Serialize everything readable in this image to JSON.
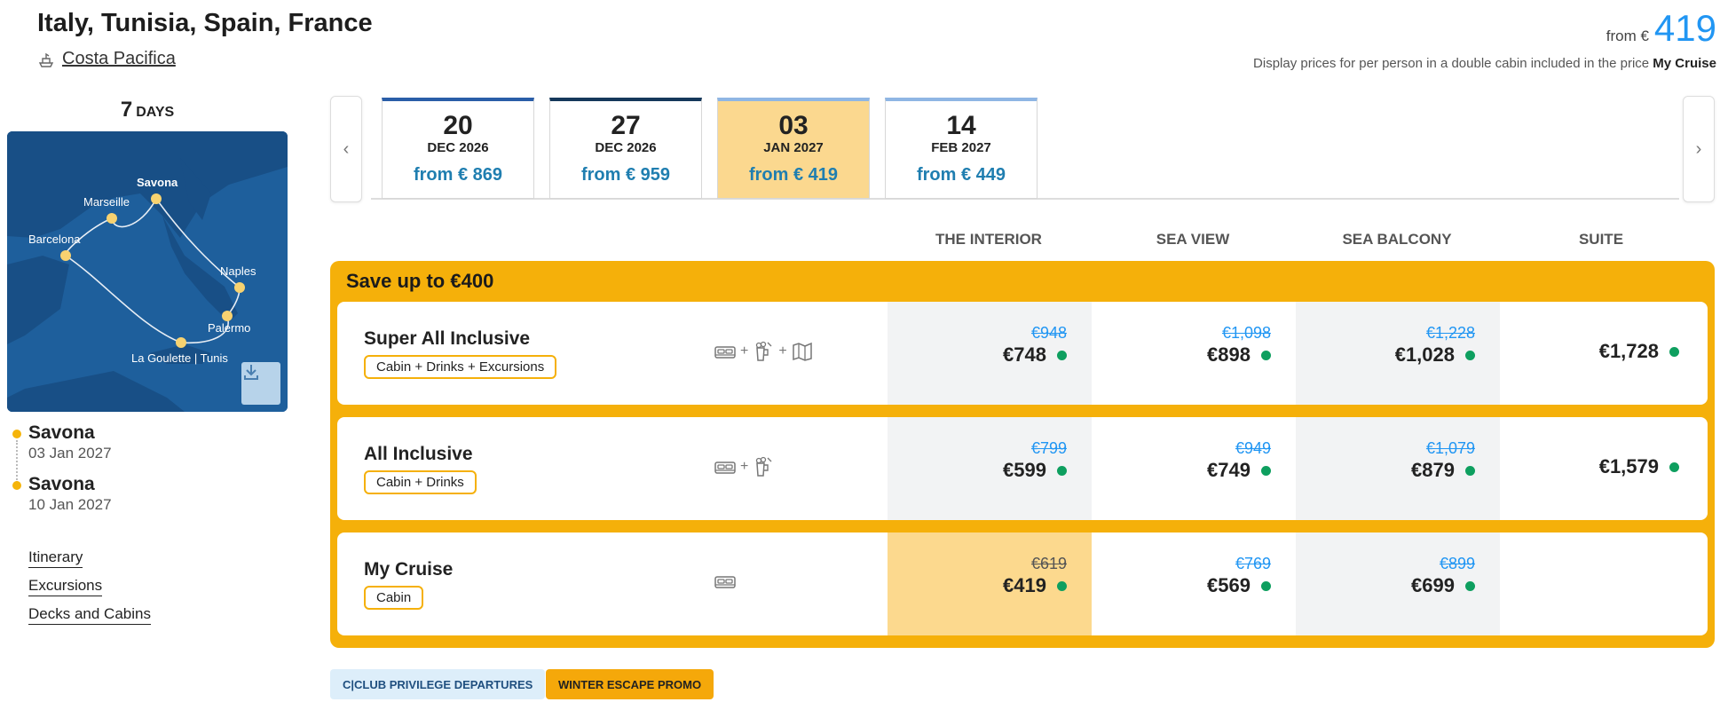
{
  "header": {
    "title": "Italy, Tunisia, Spain, France",
    "ship": "Costa Pacifica",
    "from_label": "from €",
    "from_price": "419",
    "note_prefix": "Display prices for per person in a double cabin included in the price",
    "note_bold": "My Cruise"
  },
  "duration": {
    "number": "7",
    "unit": "DAYS"
  },
  "map": {
    "labels": [
      "Savona",
      "Marseille",
      "Barcelona",
      "Naples",
      "Palermo",
      "La Goulette | Tunis"
    ],
    "download_icon": "download-icon"
  },
  "ports": [
    {
      "name": "Savona",
      "date": "03 Jan 2027"
    },
    {
      "name": "Savona",
      "date": "10 Jan 2027"
    }
  ],
  "links": [
    "Itinerary",
    "Excursions",
    "Decks and Cabins"
  ],
  "date_tabs": [
    {
      "day": "20",
      "month": "DEC 2026",
      "price": "from € 869",
      "accent": "#2a5ea8"
    },
    {
      "day": "27",
      "month": "DEC 2026",
      "price": "from € 959",
      "accent": "#15385b"
    },
    {
      "day": "03",
      "month": "JAN 2027",
      "price": "from € 419",
      "accent": "#8fb6e4",
      "active": true
    },
    {
      "day": "14",
      "month": "FEB 2027",
      "price": "from € 449",
      "accent": "#8fb6e4"
    }
  ],
  "nav": {
    "prev": "‹",
    "next": "›"
  },
  "columns": [
    "THE INTERIOR",
    "SEA VIEW",
    "SEA BALCONY",
    "SUITE"
  ],
  "save_title": "Save up to €400",
  "packages": [
    {
      "name": "Super All Inclusive",
      "badge": "Cabin + Drinks + Excursions",
      "icons": [
        "bed-icon",
        "drinks-icon",
        "map-icon"
      ],
      "prices": [
        {
          "old": "€948",
          "cur": "€748"
        },
        {
          "old": "€1,098",
          "cur": "€898"
        },
        {
          "old": "€1,228",
          "cur": "€1,028"
        },
        {
          "old": "",
          "cur": "€1,728"
        }
      ]
    },
    {
      "name": "All Inclusive",
      "badge": "Cabin + Drinks",
      "icons": [
        "bed-icon",
        "drinks-icon"
      ],
      "prices": [
        {
          "old": "€799",
          "cur": "€599"
        },
        {
          "old": "€949",
          "cur": "€749"
        },
        {
          "old": "€1,079",
          "cur": "€879"
        },
        {
          "old": "",
          "cur": "€1,579"
        }
      ]
    },
    {
      "name": "My Cruise",
      "badge": "Cabin",
      "icons": [
        "bed-icon"
      ],
      "prices": [
        {
          "old": "€619",
          "cur": "€419"
        },
        {
          "old": "€769",
          "cur": "€569"
        },
        {
          "old": "€899",
          "cur": "€699"
        }
      ]
    }
  ],
  "promos": [
    "C|CLUB PRIVILEGE DEPARTURES",
    "WINTER ESCAPE PROMO"
  ],
  "colors": {
    "accent_orange": "#f5b00a",
    "price_blue": "#2196f3",
    "available_green": "#0e9f5f",
    "selected_yellow": "#fbd88f"
  }
}
